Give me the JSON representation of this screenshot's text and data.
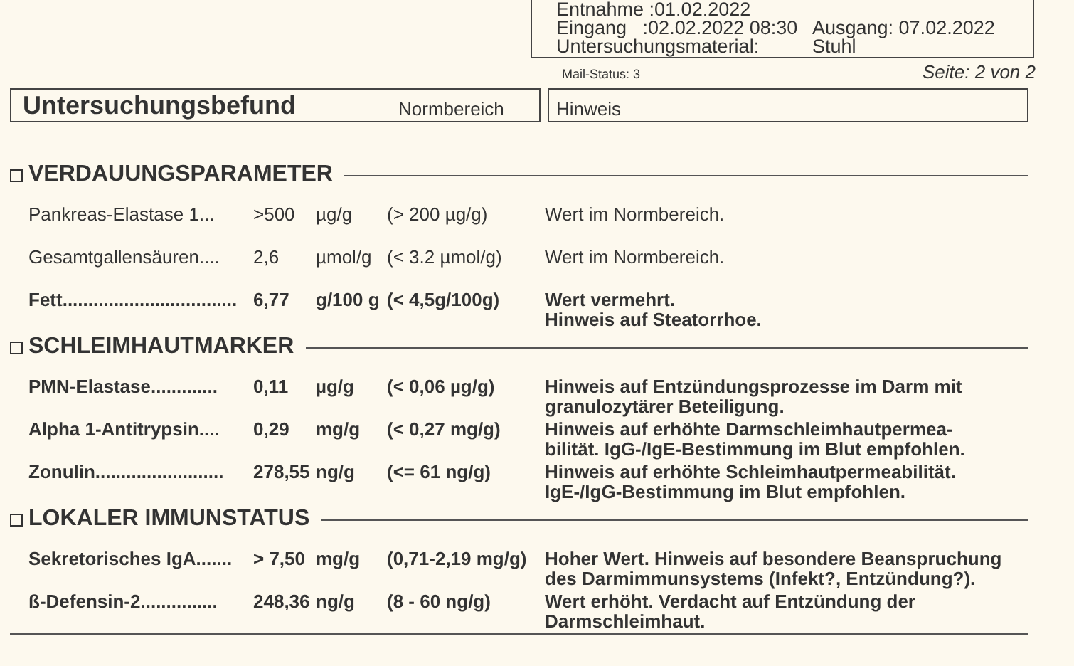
{
  "info_box": {
    "lines": [
      {
        "label": "Entnahme :01.02.2022"
      },
      {
        "label": "Eingang   :02.02.2022 08:30",
        "value": "Ausgang: 07.02.2022"
      },
      {
        "label": "Untersuchungsmaterial:",
        "value": "Stuhl"
      }
    ]
  },
  "mail_status": "Mail-Status: 3",
  "page": "Seite: 2 von 2",
  "header": {
    "title": "Untersuchungsbefund",
    "range": "Normbereich",
    "hint": "Hinweis"
  },
  "sections": [
    {
      "title": "VERDAUUNGSPARAMETER",
      "rows": [
        {
          "name": "Pankreas-Elastase 1...",
          "value": ">500",
          "unit": "µg/g",
          "range": "(> 200 µg/g)",
          "hint": "Wert im Normbereich.",
          "flagged": false
        },
        {
          "name": "Gesamtgallensäuren....",
          "value": "2,6",
          "unit": "µmol/g",
          "range": "(< 3.2 µmol/g)",
          "hint": "Wert im Normbereich.",
          "flagged": false
        },
        {
          "name": "Fett..................................",
          "value": "6,77",
          "unit": "g/100 g",
          "range": "(< 4,5g/100g)",
          "hint": "Wert vermehrt.\nHinweis auf Steatorrhoe.",
          "flagged": true
        }
      ]
    },
    {
      "title": "SCHLEIMHAUTMARKER",
      "rows": [
        {
          "name": "PMN-Elastase.............",
          "value": "0,11",
          "unit": "µg/g",
          "range": "(< 0,06 µg/g)",
          "hint": "Hinweis auf Entzündungsprozesse im Darm mit\ngranulozytärer Beteiligung.",
          "flagged": true
        },
        {
          "name": "Alpha 1-Antitrypsin....",
          "value": "0,29",
          "unit": "mg/g",
          "range": "(< 0,27 mg/g)",
          "hint": "Hinweis auf erhöhte Darmschleimhautpermea-\nbilität. IgG-/IgE-Bestimmung im Blut empfohlen.",
          "flagged": true
        },
        {
          "name": "Zonulin.........................",
          "value": "278,55",
          "unit": "ng/g",
          "range": "(<= 61 ng/g)",
          "hint": "Hinweis auf erhöhte Schleimhautpermeabilität.\nIgE-/IgG-Bestimmung im Blut empfohlen.",
          "flagged": true
        }
      ]
    },
    {
      "title": "LOKALER IMMUNSTATUS",
      "rows": [
        {
          "name": "Sekretorisches IgA.......",
          "value": "> 7,50",
          "unit": "mg/g",
          "range": "(0,71-2,19 mg/g)",
          "hint": "Hoher Wert. Hinweis auf besondere Beanspruchung\ndes Darmimmunsystems (Infekt?, Entzündung?).",
          "flagged": true
        },
        {
          "name": "ß-Defensin-2...............",
          "value": "248,36",
          "unit": "ng/g",
          "range": "(8 - 60 ng/g)",
          "hint": "Wert erhöht. Verdacht auf Entzündung der\nDarmschleimhaut.",
          "flagged": true
        }
      ]
    }
  ]
}
